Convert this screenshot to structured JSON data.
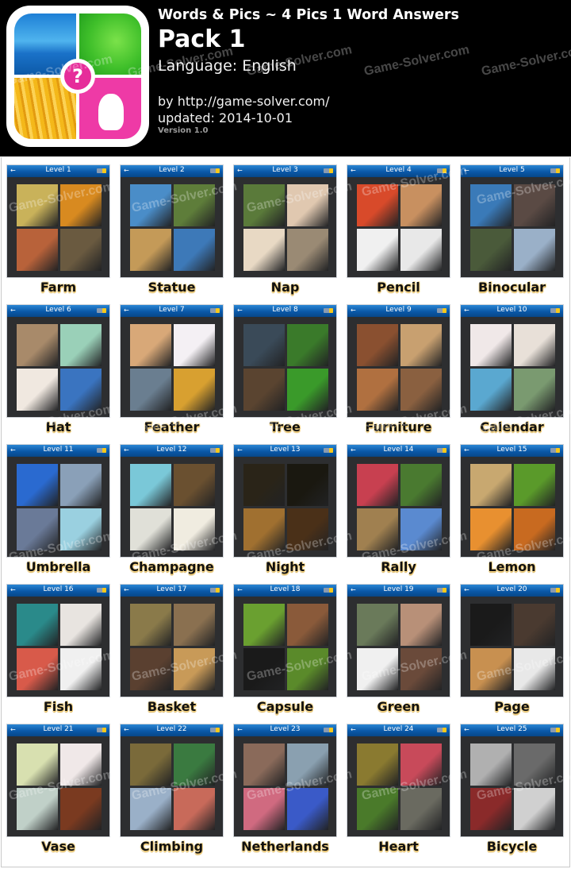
{
  "header": {
    "title": "Words & Pics ~ 4 Pics 1 Word Answers",
    "pack": "Pack 1",
    "language": "Language: English",
    "by": "by http://game-solver.com/",
    "updated": "updated: 2014-10-01",
    "version": "Version 1.0",
    "app_icon": {
      "center_glyph": "?",
      "accent": "#e62d9a"
    }
  },
  "watermark": "Game-Solver.com",
  "card_style": {
    "header_color": "#0a58a8",
    "body_color": "#2d2e30",
    "back_icon": "←",
    "battery_icon": "battery-icon"
  },
  "levels": [
    {
      "level": "Level 1",
      "answer": "Farm",
      "colors": [
        "#c9b25a",
        "#d88a20",
        "#b8623a",
        "#6a5a40"
      ]
    },
    {
      "level": "Level 2",
      "answer": "Statue",
      "colors": [
        "#4a8dc8",
        "#5e7d3a",
        "#c49a58",
        "#3d79b8"
      ]
    },
    {
      "level": "Level 3",
      "answer": "Nap",
      "colors": [
        "#5a7a3a",
        "#e0c8b0",
        "#e8d9c4",
        "#9a8a74"
      ]
    },
    {
      "level": "Level 4",
      "answer": "Pencil",
      "colors": [
        "#d84a2a",
        "#c89060",
        "#f0f0f0",
        "#e8e8e8"
      ]
    },
    {
      "level": "Level 5",
      "answer": "Binocular",
      "colors": [
        "#3a7ab8",
        "#5a4a44",
        "#4a5a3a",
        "#9ab0c8"
      ]
    },
    {
      "level": "Level 6",
      "answer": "Hat",
      "colors": [
        "#a88a6a",
        "#9ad0b8",
        "#f0e8e0",
        "#3a74c0"
      ]
    },
    {
      "level": "Level 7",
      "answer": "Feather",
      "colors": [
        "#d8a878",
        "#f4f0f4",
        "#6a7e90",
        "#d8a030"
      ]
    },
    {
      "level": "Level 8",
      "answer": "Tree",
      "colors": [
        "#3a4a58",
        "#3a7a2a",
        "#5a4430",
        "#3a9a2a"
      ]
    },
    {
      "level": "Level 9",
      "answer": "Furniture",
      "colors": [
        "#8a5030",
        "#c8a070",
        "#b07040",
        "#8a6040"
      ]
    },
    {
      "level": "Level 10",
      "answer": "Calendar",
      "colors": [
        "#f0e8e8",
        "#e8e0d8",
        "#5aa8d0",
        "#7a9a70"
      ]
    },
    {
      "level": "Level 11",
      "answer": "Umbrella",
      "colors": [
        "#2a6ad0",
        "#8aa0b8",
        "#6a7a98",
        "#9ad0e0"
      ]
    },
    {
      "level": "Level 12",
      "answer": "Champagne",
      "colors": [
        "#7ac8d8",
        "#6a5030",
        "#e0e0d8",
        "#f0ece0"
      ]
    },
    {
      "level": "Level 13",
      "answer": "Night",
      "colors": [
        "#2a2418",
        "#1a1810",
        "#a07030",
        "#4a3018"
      ]
    },
    {
      "level": "Level 14",
      "answer": "Rally",
      "colors": [
        "#c84050",
        "#4a7a30",
        "#a08050",
        "#5a8ad0"
      ]
    },
    {
      "level": "Level 15",
      "answer": "Lemon",
      "colors": [
        "#c8a870",
        "#5a9a2a",
        "#e89030",
        "#c86a20"
      ]
    },
    {
      "level": "Level 16",
      "answer": "Fish",
      "colors": [
        "#2a8a8a",
        "#e8e4e0",
        "#d85a4a",
        "#f0f0f0"
      ]
    },
    {
      "level": "Level 17",
      "answer": "Basket",
      "colors": [
        "#8a7a4a",
        "#8a7050",
        "#5a4030",
        "#c89a58"
      ]
    },
    {
      "level": "Level 18",
      "answer": "Capsule",
      "colors": [
        "#6aa030",
        "#8a5a3a",
        "#1a1a1a",
        "#5a8a2a"
      ]
    },
    {
      "level": "Level 19",
      "answer": "Green",
      "colors": [
        "#6a7a5a",
        "#b89078",
        "#f0f0f0",
        "#6a4a3a"
      ]
    },
    {
      "level": "Level 20",
      "answer": "Page",
      "colors": [
        "#1a1a1a",
        "#4a3a30",
        "#c89050",
        "#e8e8e8"
      ]
    },
    {
      "level": "Level 21",
      "answer": "Vase",
      "colors": [
        "#d8e0b0",
        "#f0e8e8",
        "#c0d0c8",
        "#7a3a20"
      ]
    },
    {
      "level": "Level 22",
      "answer": "Climbing",
      "colors": [
        "#7a6a3a",
        "#3a7a40",
        "#9ab0c8",
        "#c86a5a"
      ]
    },
    {
      "level": "Level 23",
      "answer": "Netherlands",
      "colors": [
        "#8a6a5a",
        "#8aa0b0",
        "#d06a80",
        "#3a5ac8"
      ]
    },
    {
      "level": "Level 24",
      "answer": "Heart",
      "colors": [
        "#8a7a30",
        "#c84a5a",
        "#4a7a2a",
        "#6a6a60"
      ]
    },
    {
      "level": "Level 25",
      "answer": "Bicycle",
      "colors": [
        "#b0b0b0",
        "#6a6a6a",
        "#8a2a2a",
        "#d0d0d0"
      ]
    }
  ]
}
